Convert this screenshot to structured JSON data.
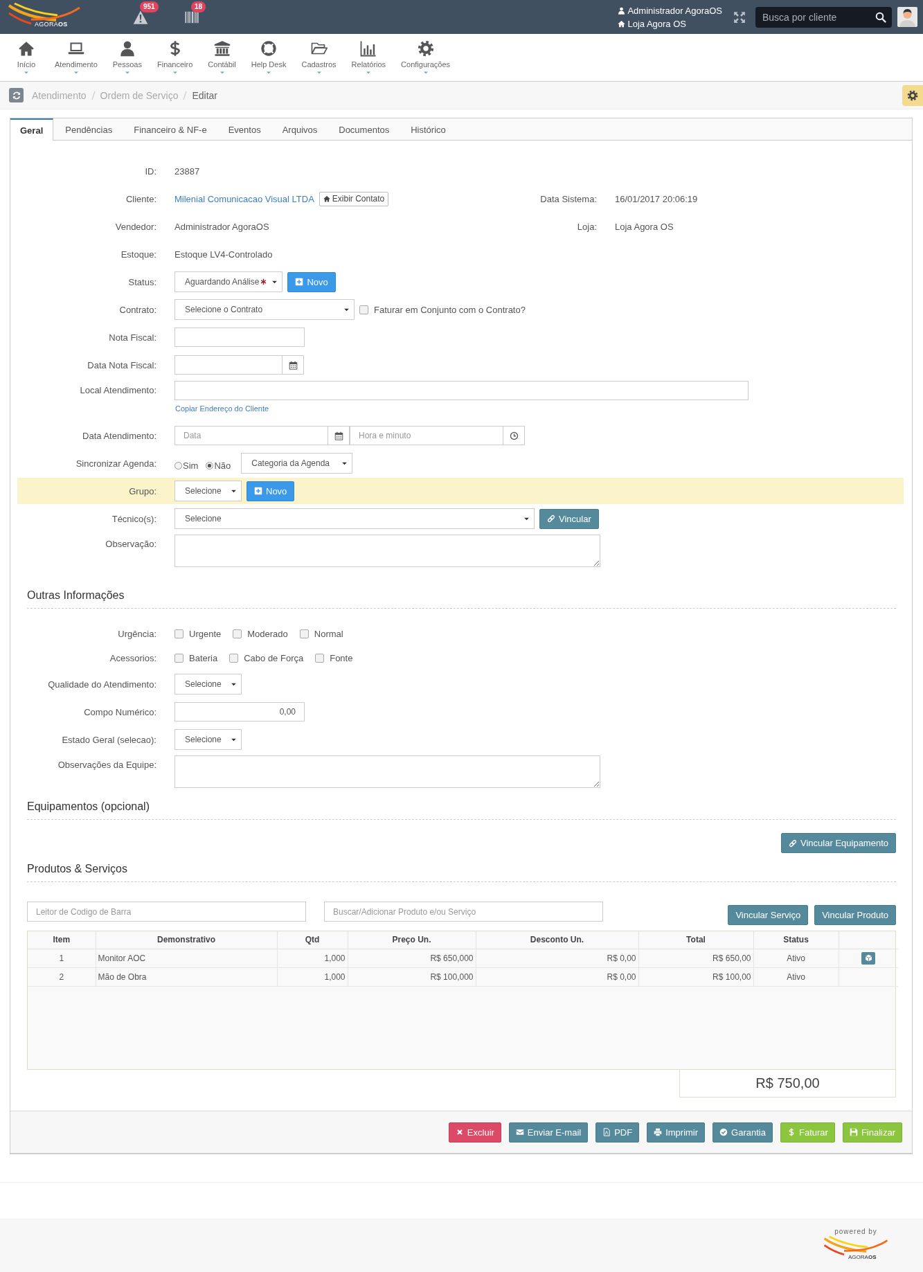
{
  "topbar": {
    "logo_text": "AGORA**OS**",
    "alerts_count": "951",
    "barcode_count": "18",
    "user": "Administrador AgoraOS",
    "store": "Loja Agora OS",
    "search": {
      "placeholder": "Busca por cliente"
    }
  },
  "nav": [
    {
      "label": "Início"
    },
    {
      "label": "Atendimento"
    },
    {
      "label": "Pessoas"
    },
    {
      "label": "Financeiro"
    },
    {
      "label": "Contábil"
    },
    {
      "label": "Help Desk"
    },
    {
      "label": "Cadastros"
    },
    {
      "label": "Relatórios"
    },
    {
      "label": "Configurações"
    }
  ],
  "breadcrumb": [
    "Atendimento",
    "Ordem de Serviço",
    "Editar"
  ],
  "tabs": [
    {
      "label": "Geral",
      "selected": true
    },
    {
      "label": "Pendências",
      "selected": false
    },
    {
      "label": "Financeiro & NF-e",
      "selected": false
    },
    {
      "label": "Eventos",
      "selected": false
    },
    {
      "label": "Arquivos",
      "selected": false
    },
    {
      "label": "Documentos",
      "selected": false
    },
    {
      "label": "Histórico",
      "selected": false
    }
  ],
  "fields": [
    {
      "kind": "text",
      "label": "ID:",
      "value": "23887"
    },
    {
      "kind": "link",
      "label": "Cliente:",
      "value": "Milenial Comunicacao Visual LTDA",
      "button": "Exibir Contato",
      "side_label": "Data Sistema:",
      "side_value": "16/01/2017 20:06:19"
    },
    {
      "kind": "text",
      "label": "Vendedor:",
      "value": "Administrador AgoraOS",
      "side_label": "Loja:",
      "side_value": "Loja Agora OS"
    },
    {
      "kind": "text",
      "label": "Estoque:",
      "value": "Estoque LV4-Controlado"
    },
    {
      "kind": "status",
      "label": "Status:",
      "value": "Aguardando Análise",
      "required": true,
      "button": "Novo"
    },
    {
      "kind": "contract",
      "label": "Contrato:",
      "value": "Selecione o Contrato",
      "checkbox": {
        "label": "Faturar em Conjunto com o Contrato?",
        "checked": false
      }
    },
    {
      "kind": "input",
      "label": "Nota Fiscal:"
    },
    {
      "kind": "date",
      "label": "Data Nota Fiscal:"
    },
    {
      "kind": "address",
      "label": "Local Atendimento:",
      "link": "Copiar Endereço do Cliente"
    },
    {
      "kind": "datetime",
      "label": "Data Atendimento:",
      "date_placeholder": "Data",
      "time_placeholder": "Hora e minuto"
    },
    {
      "kind": "sync",
      "label": "Sincronizar Agenda:",
      "options": [
        {
          "label": "Sim",
          "selected": false
        },
        {
          "label": "Não",
          "selected": true
        }
      ],
      "value": "Categoria da Agenda"
    },
    {
      "kind": "group",
      "label": "Grupo:",
      "value": "Selecione",
      "button": "Novo"
    },
    {
      "kind": "technicians",
      "label": "Técnico(s):",
      "value": "Selecione",
      "button": "Vincular"
    },
    {
      "kind": "textarea",
      "label": "Observação:"
    }
  ],
  "other_info": {
    "title": "Outras Informações",
    "fields": [
      {
        "kind": "checks",
        "label": "Urgência:",
        "options": [
          {
            "label": "Urgente",
            "checked": false
          },
          {
            "label": "Moderado",
            "checked": false
          },
          {
            "label": "Normal",
            "checked": false
          }
        ]
      },
      {
        "kind": "checks",
        "label": "Acessorios:",
        "options": [
          {
            "label": "Bateria",
            "checked": false
          },
          {
            "label": "Cabo de Força",
            "checked": false
          },
          {
            "label": "Fonte",
            "checked": false
          }
        ]
      },
      {
        "kind": "select",
        "label": "Qualidade do Atendimento:",
        "value": "Selecione"
      },
      {
        "kind": "number",
        "label": "Compo Numérico:",
        "value": "0,00"
      },
      {
        "kind": "select",
        "label": "Estado Geral (selecao):",
        "value": "Selecione"
      },
      {
        "kind": "textarea",
        "label": "Observações da Equipe:"
      }
    ]
  },
  "equipment": {
    "title": "Equipamentos (opcional)",
    "button": "Vincular Equipamento"
  },
  "products": {
    "title": "Produtos & Serviços",
    "barcode_placeholder": "Leitor de Codigo de Barra",
    "search_placeholder": "Buscar/Adicionar Produto e/ou Serviço",
    "buttons": [
      "Vincular Serviço",
      "Vincular Produto"
    ],
    "table": {
      "columns": [
        "Item",
        "Demonstrativo",
        "Qtd",
        "Preço Un.",
        "Desconto Un.",
        "Total",
        "Status"
      ],
      "rows": [
        {
          "cells": [
            "1",
            "Monitor AOC",
            "1,000",
            "R$ 650,000",
            "R$ 0,00",
            "R$ 650,00",
            "Ativo"
          ],
          "action": true
        },
        {
          "cells": [
            "2",
            "Mão de Obra",
            "1,000",
            "R$ 100,000",
            "R$ 0,00",
            "R$ 100,00",
            "Ativo"
          ],
          "action": false
        }
      ]
    },
    "total": "R$ 750,00"
  },
  "actions": [
    {
      "label": "Excluir",
      "kind": "danger"
    },
    {
      "label": "Enviar E-mail",
      "kind": "info"
    },
    {
      "label": "PDF",
      "kind": "info"
    },
    {
      "label": "Imprimir",
      "kind": "info"
    },
    {
      "label": "Garantia",
      "kind": "info"
    },
    {
      "label": "Faturar",
      "kind": "success"
    },
    {
      "label": "Finalizar",
      "kind": "success"
    }
  ],
  "footer": {
    "powered_by": "powered by",
    "logo_text": "AGORA**OS**"
  }
}
